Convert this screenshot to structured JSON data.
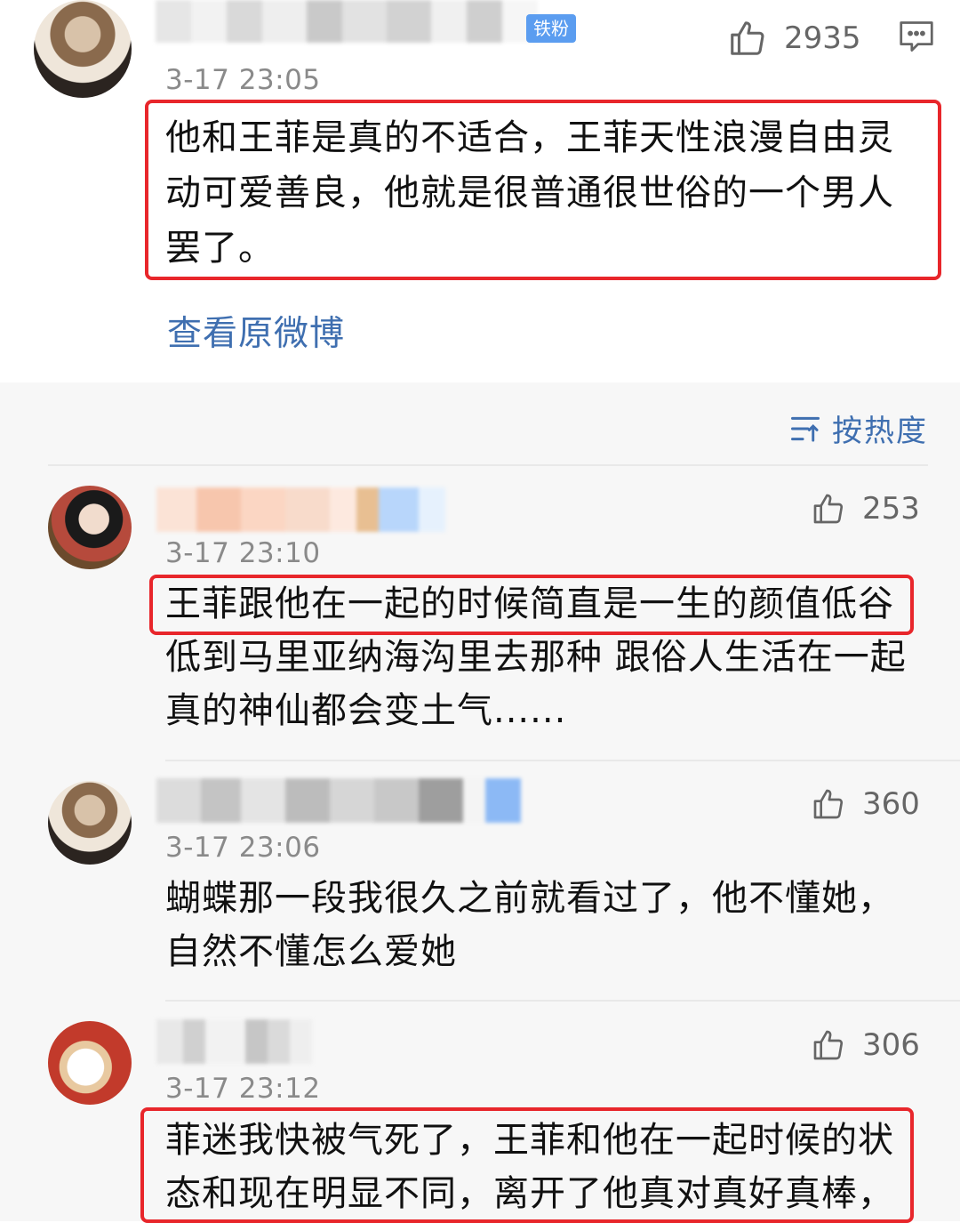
{
  "main_post": {
    "badge": "铁粉",
    "likes": "2935",
    "time": "3-17 23:05",
    "text": "他和王菲是真的不适合，王菲天性浪漫自由灵动可爱善良，他就是很普通很世俗的一个男人罢了。",
    "view_original": "查看原微博"
  },
  "sort": {
    "label": "按热度",
    "icon": "sort-icon"
  },
  "comments": [
    {
      "time": "3-17 23:10",
      "likes": "253",
      "text": "王菲跟他在一起的时候简直是一生的颜值低谷低到马里亚纳海沟里去那种 跟俗人生活在一起真的神仙都会变土气......"
    },
    {
      "time": "3-17 23:06",
      "likes": "360",
      "text": "蝴蝶那一段我很久之前就看过了，他不懂她，自然不懂怎么爱她"
    },
    {
      "time": "3-17 23:12",
      "likes": "306",
      "text": "菲迷我快被气死了，王菲和他在一起时候的状态和现在明显不同，离开了他真对真好真棒，"
    }
  ],
  "colors": {
    "highlight": "#e8262b",
    "link": "#3f6fb0",
    "comment_bg": "#f7f7f7"
  }
}
